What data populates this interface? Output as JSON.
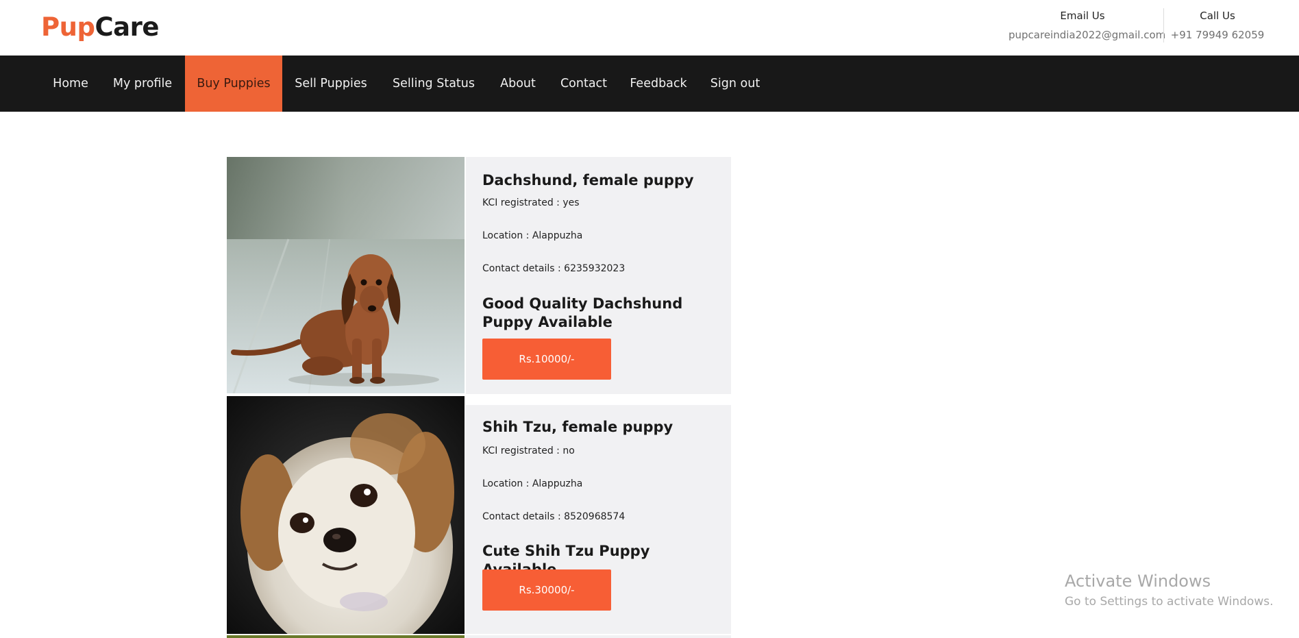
{
  "header": {
    "logo": {
      "part1": "Pup",
      "part2": "Care"
    },
    "email": {
      "label": "Email Us",
      "value": "pupcareindia2022@gmail.com"
    },
    "call": {
      "label": "Call Us",
      "value": "+91 79949 62059"
    }
  },
  "nav": {
    "items": [
      {
        "label": "Home"
      },
      {
        "label": "My profile"
      },
      {
        "label": "Buy Puppies",
        "active": true
      },
      {
        "label": "Sell Puppies"
      },
      {
        "label": "Selling Status"
      },
      {
        "label": "About"
      },
      {
        "label": "Contact"
      },
      {
        "label": "Feedback"
      },
      {
        "label": "Sign out"
      }
    ]
  },
  "listings": [
    {
      "title": "Dachshund, female puppy",
      "kci": "KCI registrated : yes",
      "location": "Location : Alappuzha",
      "contact": "Contact details : 6235932023",
      "headline": "Good Quality Dachshund Puppy Available",
      "price": "Rs.10000/-",
      "photo_icon": "dachshund-puppy-photo"
    },
    {
      "title": "Shih Tzu, female puppy",
      "kci": "KCI registrated : no",
      "location": "Location : Alappuzha",
      "contact": "Contact details : 8520968574",
      "headline": "Cute Shih Tzu Puppy Available",
      "price": "Rs.30000/-",
      "photo_icon": "shih-tzu-puppy-photo"
    }
  ],
  "watermark": {
    "line1": "Activate Windows",
    "line2": "Go to Settings to activate Windows."
  },
  "colors": {
    "accent": "#ee6436",
    "button": "#f75e35",
    "nav_bg": "#181818",
    "card_bg": "#f1f1f3"
  }
}
